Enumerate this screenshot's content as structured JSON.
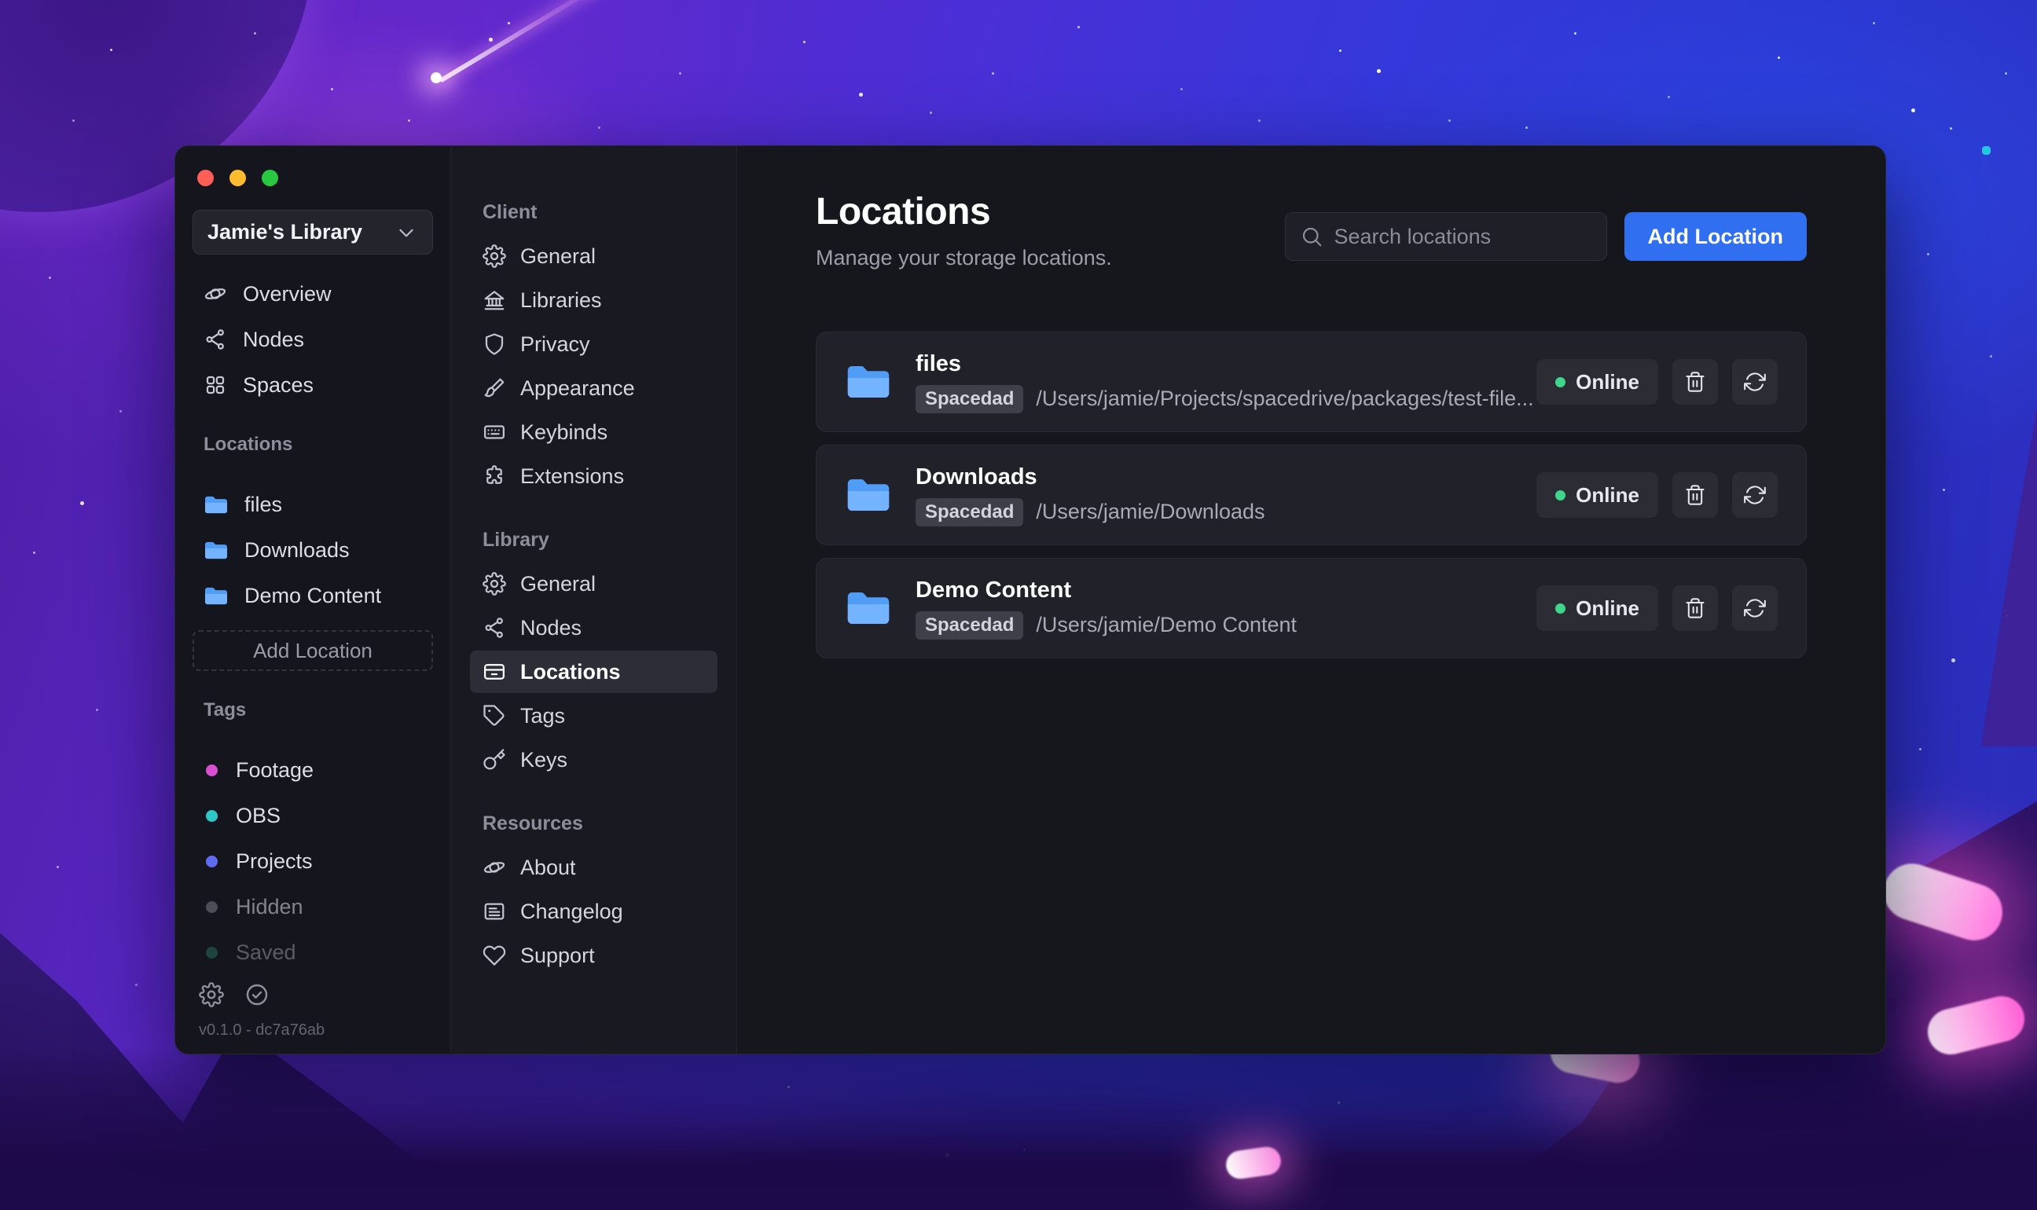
{
  "window": {
    "sidebar": {
      "library_name": "Jamie's Library",
      "nav": [
        {
          "label": "Overview"
        },
        {
          "label": "Nodes"
        },
        {
          "label": "Spaces"
        }
      ],
      "locations_header": "Locations",
      "locations": [
        {
          "label": "files"
        },
        {
          "label": "Downloads"
        },
        {
          "label": "Demo Content"
        }
      ],
      "add_location": "Add Location",
      "tags_header": "Tags",
      "tags": [
        {
          "label": "Footage",
          "color": "#d94fd4"
        },
        {
          "label": "OBS",
          "color": "#2ec8c8"
        },
        {
          "label": "Projects",
          "color": "#5f6bf2"
        },
        {
          "label": "Hidden",
          "color": "#7a7d87"
        },
        {
          "label": "Saved",
          "color": "#2f9e7a"
        }
      ],
      "version": "v0.1.0 - dc7a76ab"
    },
    "settings_nav": {
      "sections": [
        {
          "title": "Client",
          "items": [
            {
              "label": "General"
            },
            {
              "label": "Libraries"
            },
            {
              "label": "Privacy"
            },
            {
              "label": "Appearance"
            },
            {
              "label": "Keybinds"
            },
            {
              "label": "Extensions"
            }
          ]
        },
        {
          "title": "Library",
          "items": [
            {
              "label": "General"
            },
            {
              "label": "Nodes"
            },
            {
              "label": "Locations"
            },
            {
              "label": "Tags"
            },
            {
              "label": "Keys"
            }
          ]
        },
        {
          "title": "Resources",
          "items": [
            {
              "label": "About"
            },
            {
              "label": "Changelog"
            },
            {
              "label": "Support"
            }
          ]
        }
      ]
    },
    "main": {
      "title": "Locations",
      "subtitle": "Manage your storage locations.",
      "search_placeholder": "Search locations",
      "add_location_button": "Add Location",
      "locations": [
        {
          "name": "files",
          "node_badge": "Spacedad",
          "path": "/Users/jamie/Projects/spacedrive/packages/test-file...",
          "status": "Online"
        },
        {
          "name": "Downloads",
          "node_badge": "Spacedad",
          "path": "/Users/jamie/Downloads",
          "status": "Online"
        },
        {
          "name": "Demo Content",
          "node_badge": "Spacedad",
          "path": "/Users/jamie/Demo Content",
          "status": "Online"
        }
      ]
    }
  },
  "colors": {
    "accent": "#2f6ff0",
    "online_dot": "#3fd68c",
    "folder_blue": "#4f9df6"
  }
}
